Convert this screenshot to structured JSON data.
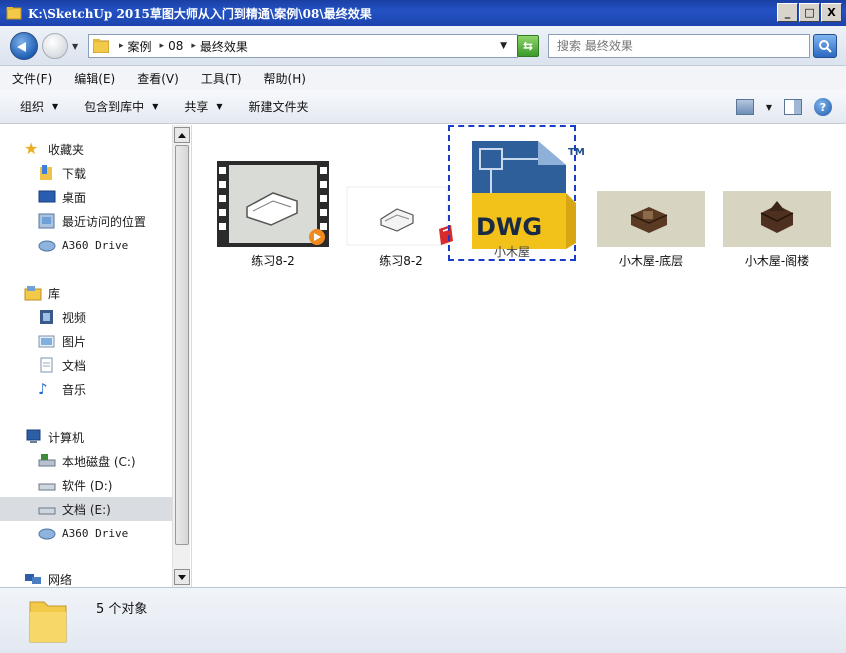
{
  "window": {
    "title": "K:\\SketchUp 2015草图大师从入门到精通\\案例\\08\\最终效果",
    "buttons": {
      "minimize": "_",
      "maximize": "□",
      "close": "X"
    }
  },
  "address": {
    "crumbs": [
      "案例",
      "08",
      "最终效果"
    ],
    "search_placeholder": "搜索 最终效果"
  },
  "menu": [
    "文件(F)",
    "编辑(E)",
    "查看(V)",
    "工具(T)",
    "帮助(H)"
  ],
  "commands": [
    "组织",
    "包含到库中",
    "共享",
    "新建文件夹"
  ],
  "nav": {
    "favorites": {
      "label": "收藏夹",
      "items": [
        "下载",
        "桌面",
        "最近访问的位置",
        "A360 Drive"
      ]
    },
    "libraries": {
      "label": "库",
      "items": [
        "视频",
        "图片",
        "文档",
        "音乐"
      ]
    },
    "computer": {
      "label": "计算机",
      "items": [
        "本地磁盘 (C:)",
        "软件 (D:)",
        "文档 (E:)",
        "A360 Drive"
      ]
    },
    "network": {
      "label": "网络"
    }
  },
  "files": [
    {
      "label": "练习8-2",
      "kind": "video"
    },
    {
      "label": "练习8-2",
      "kind": "skp"
    },
    {
      "label": "小木屋",
      "kind": "dwg",
      "badge_text": "DWG",
      "tm": "TM"
    },
    {
      "label": "小木屋-底层",
      "kind": "image"
    },
    {
      "label": "小木屋-阁楼",
      "kind": "image"
    }
  ],
  "status": {
    "count_text": "5 个对象"
  },
  "colors": {
    "title_bar": "#2452c4",
    "selection_dash": "#1a3cc8",
    "dwg_yellow": "#f2c21b",
    "dwg_blue": "#1f4f8c"
  }
}
